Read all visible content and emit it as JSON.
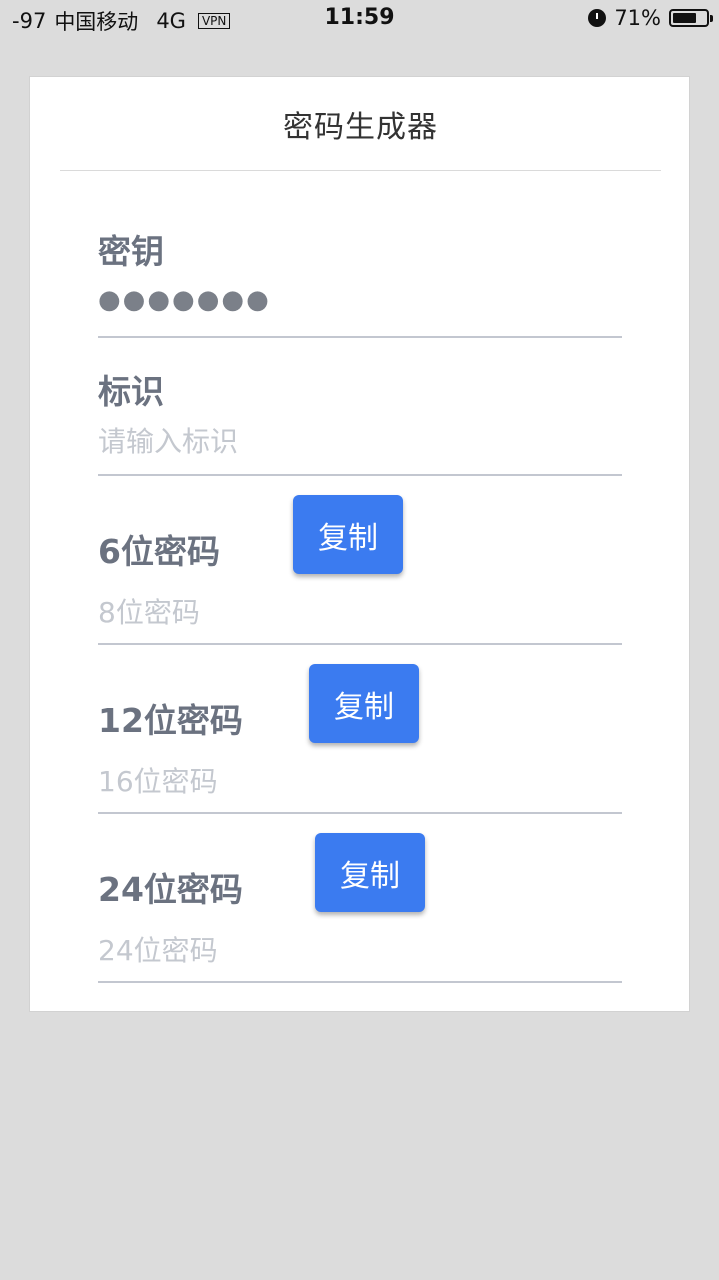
{
  "status_bar": {
    "signal": "-97",
    "carrier": "中国移动",
    "network": "4G",
    "vpn": "VPN",
    "time": "11:59",
    "battery": "71%",
    "battery_level": 0.71
  },
  "app": {
    "title": "密码生成器"
  },
  "fields": {
    "key": {
      "label": "密钥",
      "value": "●●●●●●●"
    },
    "identifier": {
      "label": "标识",
      "placeholder": "请输入标识"
    },
    "pw6": {
      "label": "6位密码",
      "value": "8位密码",
      "button": "复制"
    },
    "pw12": {
      "label": "12位密码",
      "value": "16位密码",
      "button": "复制"
    },
    "pw24": {
      "label": "24位密码",
      "value": "24位密码",
      "button": "复制"
    }
  },
  "colors": {
    "accent": "#3b7bf0",
    "background": "#dcdcdc",
    "card": "#ffffff"
  }
}
